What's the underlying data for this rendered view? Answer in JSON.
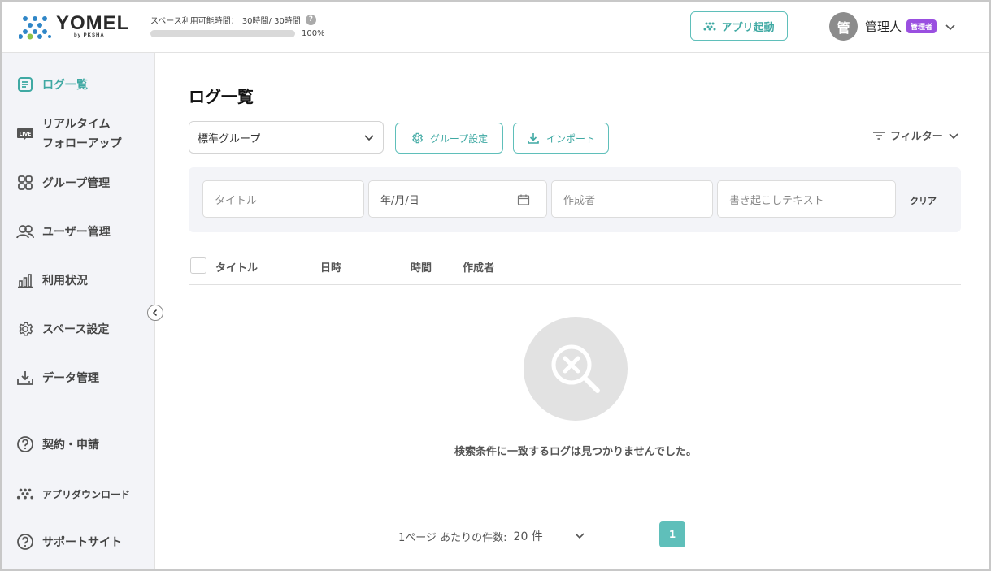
{
  "header": {
    "logo_text": "YOMEL",
    "logo_sub": "by PKSHA",
    "usage_label": "スペース利用可能時間：",
    "usage_value": "30時間/ 30時間",
    "usage_help": "?",
    "usage_progress": 1.0,
    "usage_percent": "100%",
    "launch_label": "アプリ起動",
    "avatar_char": "管",
    "user_name": "管理人",
    "role_badge": "管理者"
  },
  "sidebar": {
    "items": [
      {
        "label": "ログ一覧",
        "icon": "log-list-icon",
        "active": true
      },
      {
        "label": "リアルタイム",
        "label2": "フォローアップ",
        "icon": "live-icon"
      },
      {
        "label": "グループ管理",
        "icon": "grid-icon"
      },
      {
        "label": "ユーザー管理",
        "icon": "users-icon"
      },
      {
        "label": "利用状況",
        "icon": "bar-chart-icon"
      },
      {
        "label": "スペース設定",
        "icon": "gear-icon"
      },
      {
        "label": "データ管理",
        "icon": "download-tray-icon"
      },
      {
        "label": "契約・申請",
        "icon": "question-circle-icon"
      },
      {
        "label": "アプリダウンロード",
        "icon": "app-logo-icon"
      },
      {
        "label": "サポートサイト",
        "icon": "question-circle-icon"
      }
    ]
  },
  "main": {
    "title": "ログ一覧",
    "group_select": "標準グループ",
    "group_settings_label": "グループ設定",
    "import_label": "インポート",
    "filter_label": "フィルター",
    "filters": {
      "title_placeholder": "タイトル",
      "date_placeholder": "年/月/日",
      "author_placeholder": "作成者",
      "transcript_placeholder": "書き起こしテキスト",
      "clear_label": "クリア"
    },
    "columns": [
      "タイトル",
      "日時",
      "時間",
      "作成者"
    ],
    "empty_message": "検索条件に一致するログは見つかりませんでした。",
    "pagination": {
      "per_page_label": "1ページ あたりの件数:",
      "per_page_value": "20 件",
      "current_page": "1"
    }
  },
  "colors": {
    "accent": "#3fa9a3",
    "accent_light": "#5fbfba",
    "badge": "#9a4fe0",
    "sidebar_bg": "#f3f4f8"
  }
}
